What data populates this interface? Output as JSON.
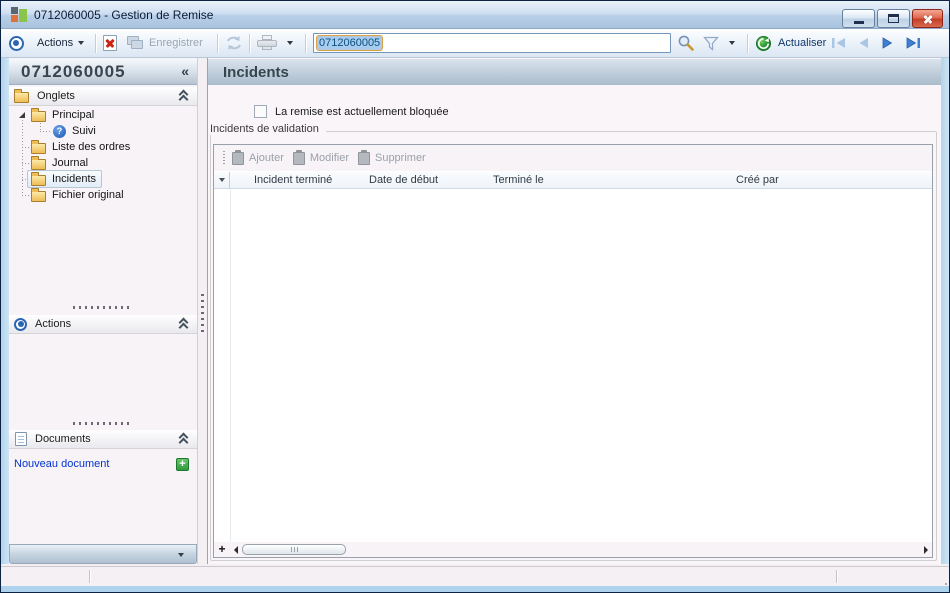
{
  "window": {
    "title": "0712060005 -  Gestion de Remise"
  },
  "toolbar": {
    "actions_label": "Actions",
    "save_label": "Enregistrer",
    "record_input_value": "0712060005",
    "refresh_label": "Actualiser"
  },
  "sidebar": {
    "header_id": "0712060005",
    "collapse_glyph": "«",
    "sections": {
      "onglets": "Onglets",
      "actions": "Actions",
      "documents": "Documents"
    },
    "tree": {
      "principal": "Principal",
      "suivi": "Suivi",
      "liste": "Liste des ordres",
      "journal": "Journal",
      "incidents": "Incidents",
      "fichier": "Fichier original"
    },
    "new_document": "Nouveau document",
    "new_document_glyph": "+"
  },
  "main": {
    "title": "Incidents",
    "blocked_checkbox_label": "La remise est actuellement bloquée",
    "checkbox_checked": false,
    "groupbox_label": "Incidents de validation",
    "grid_toolbar": {
      "add": "Ajouter",
      "edit": "Modifier",
      "delete": "Supprimer"
    },
    "columns": {
      "c1": "Incident terminé",
      "c2": "Date de début",
      "c3": "Terminé le",
      "c4": "Créé par"
    },
    "rows": [],
    "add_row_glyph": "+"
  },
  "statusbar": {
    "panel_left": "",
    "panel_middle": "",
    "panel_right": ""
  },
  "colors": {
    "accent_blue": "#2b65b5",
    "selection": "#a6cdf0",
    "link": "#0433d0",
    "green_plus": "#2f9a3e"
  }
}
